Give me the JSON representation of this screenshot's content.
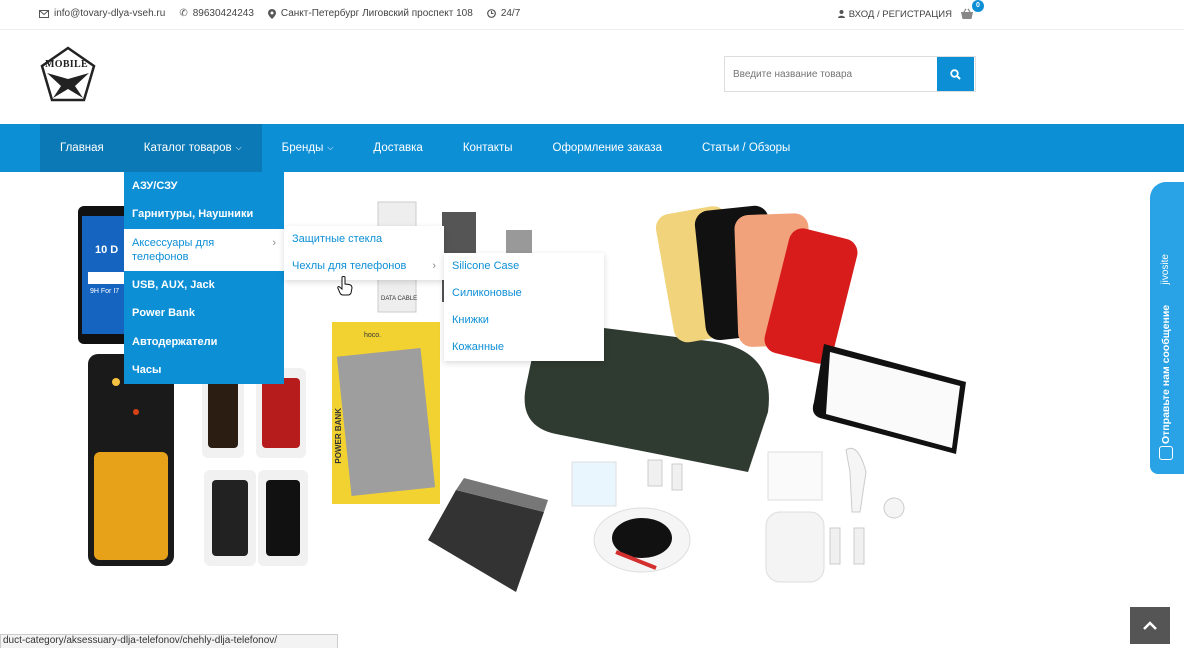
{
  "topbar": {
    "email": "info@tovary-dlya-vseh.ru",
    "phone": "89630424243",
    "address": "Санкт-Петербург Лиговский проспект 108",
    "hours": "24/7",
    "login": "ВХОД / РЕГИСТРАЦИЯ",
    "cart_count": "0"
  },
  "logo": {
    "text": "MOBILE"
  },
  "search": {
    "placeholder": "Введите название товара"
  },
  "nav": {
    "items": [
      {
        "label": "Главная"
      },
      {
        "label": "Каталог товаров"
      },
      {
        "label": "Бренды"
      },
      {
        "label": "Доставка"
      },
      {
        "label": "Контакты"
      },
      {
        "label": "Оформление заказа"
      },
      {
        "label": "Статьи / Обзоры"
      }
    ]
  },
  "catalog_menu": [
    "АЗУ/СЗУ",
    "Гарнитуры, Наушники",
    "Аксессуары для телефонов",
    "USB, AUX, Jack",
    "Power Bank",
    "Автодержатели",
    "Часы"
  ],
  "accessories_menu": [
    "Защитные стекла",
    "Чехлы для телефонов"
  ],
  "cases_menu": [
    "Silicone Case",
    "Силиконовые",
    "Книжки",
    "Кожанные"
  ],
  "banner": {
    "screen_glass_text": "10 D",
    "screen_glass_sub": "9H For I7",
    "cable_box_text": "DATA CABLE",
    "powerbank_box_text": "POWER BANK",
    "brand_hoco": "hoco."
  },
  "jivo": {
    "brand": "jivosite",
    "message": "Отправьте нам сообщение"
  },
  "status_bar": "duct-category/aksessuary-dlja-telefonov/chehly-dlja-telefonov/",
  "colors": {
    "accent": "#0d8fd6",
    "accent_dark": "#0b79b5",
    "jivo": "#29a3e6"
  }
}
